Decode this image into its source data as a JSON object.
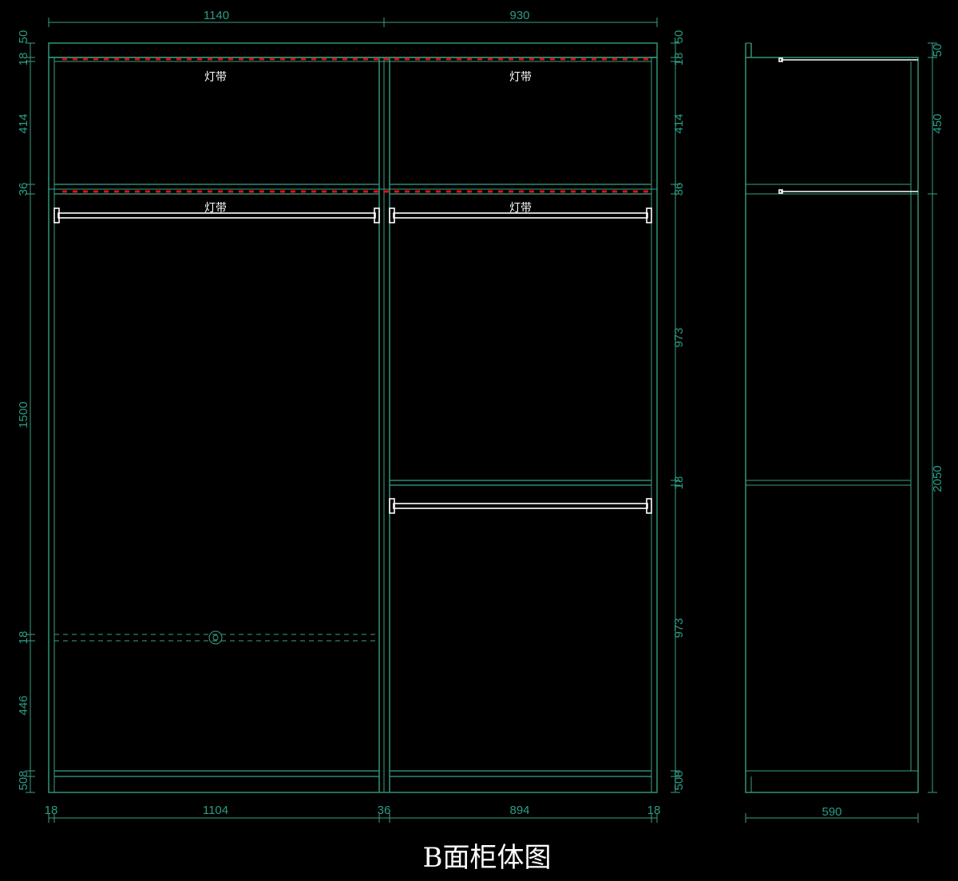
{
  "title": "B面柜体图",
  "colors": {
    "background": "#000000",
    "frame": "#2e8b72",
    "dimension_text": "#2a9d86",
    "rod": "#ffffff",
    "light_strip": "#e01010"
  },
  "light_strip_label": "灯带",
  "top_dims": {
    "left": "1140",
    "right": "930"
  },
  "bottom_dims": {
    "a": "18",
    "b": "1104",
    "c": "36",
    "d": "894",
    "e": "18"
  },
  "left_dims": {
    "d50": "50",
    "d18a": "18",
    "d414": "414",
    "d36": "36",
    "d1500": "1500",
    "d18b": "18",
    "d446": "446",
    "d508": "508"
  },
  "right_dims": {
    "d50": "50",
    "d18a": "18",
    "d414": "414",
    "d36": "36",
    "d973a": "973",
    "d18b": "18",
    "d973b": "973",
    "d508": "508"
  },
  "side_view": {
    "depth": "590",
    "d50": "50",
    "d450": "450",
    "d2050": "2050"
  }
}
